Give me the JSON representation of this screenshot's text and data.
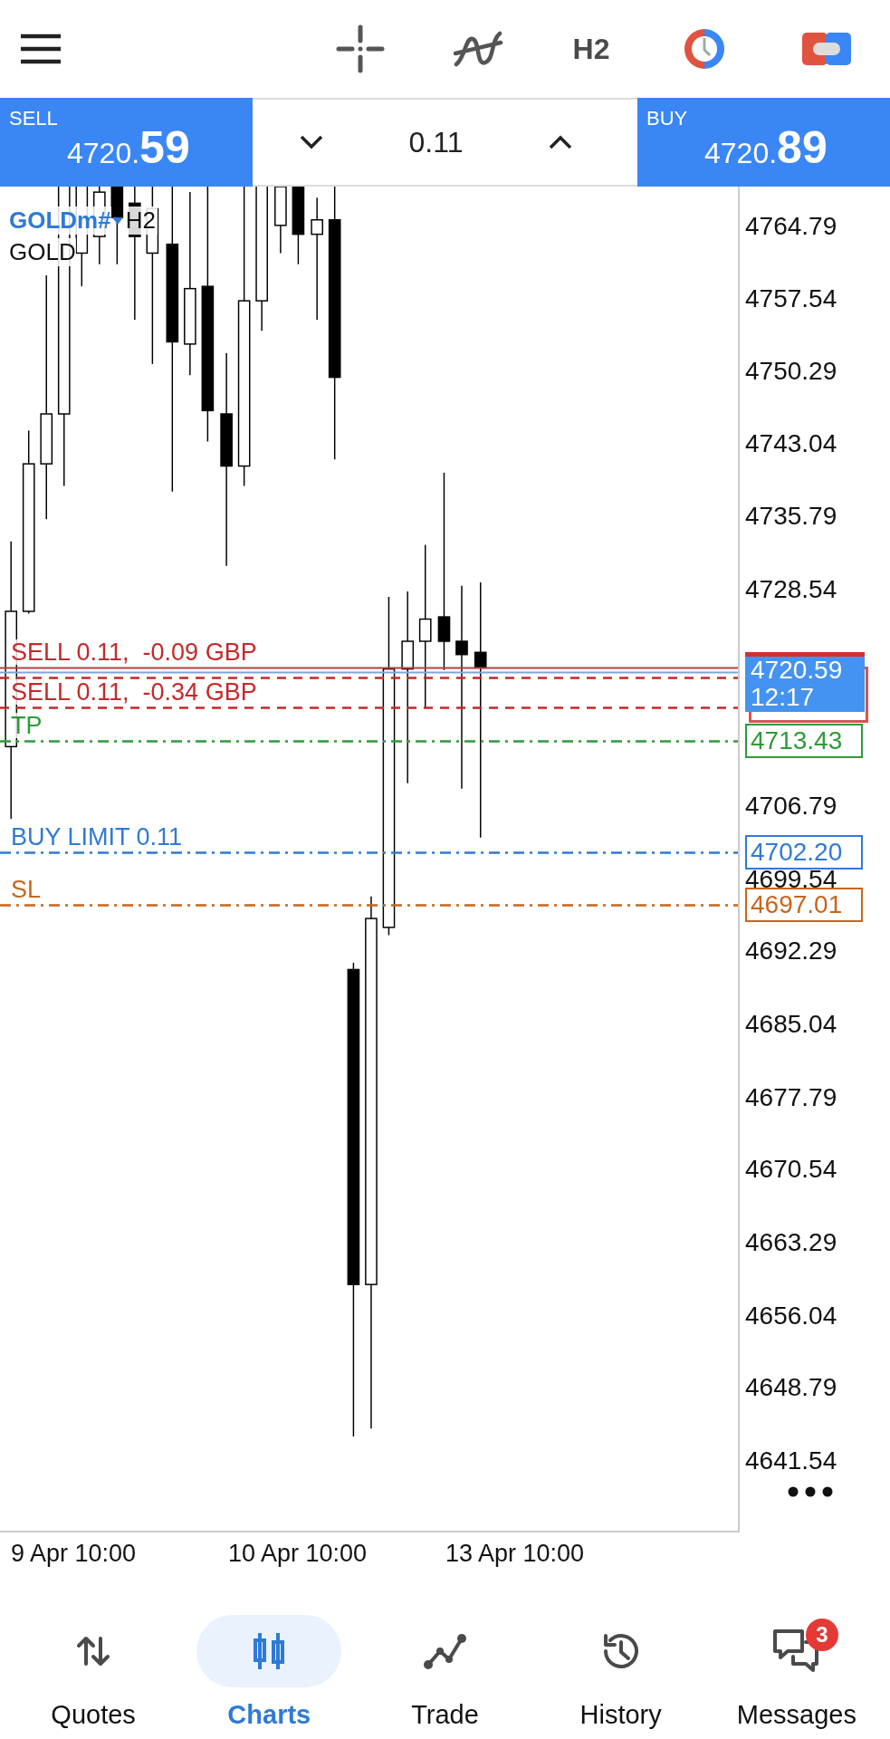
{
  "toolbar": {
    "period": "H2"
  },
  "trade_panel": {
    "sell": {
      "label": "SELL",
      "price_main": "4720.",
      "price_big": "59"
    },
    "volume": "0.11",
    "buy": {
      "label": "BUY",
      "price_main": "4720.",
      "price_big": "89"
    }
  },
  "chart": {
    "symbol": "GOLDm#",
    "timeframe": "H2",
    "description": "GOLD",
    "price_axis": [
      "4764.79",
      "4757.54",
      "4750.29",
      "4743.04",
      "4735.79",
      "4728.54",
      "4706.79",
      "4699.54",
      "4692.29",
      "4685.04",
      "4677.79",
      "4670.54",
      "4663.29",
      "4656.04",
      "4648.79",
      "4641.54"
    ],
    "order_lines": [
      {
        "kind": "position",
        "label": "SELL 0.11,  -0.09 GBP",
        "color": "#c62828"
      },
      {
        "kind": "position",
        "label": "SELL 0.11,  -0.34 GBP",
        "color": "#c62828"
      },
      {
        "kind": "tp",
        "label": "TP",
        "price": "4713.43",
        "color": "#2e9a3a"
      },
      {
        "kind": "limit",
        "label": "BUY LIMIT 0.11",
        "price": "4702.20",
        "color": "#2f7ad6"
      },
      {
        "kind": "sl",
        "label": "SL",
        "price": "4697.01",
        "color": "#c8651b"
      }
    ],
    "current_price": {
      "price": "4720.59",
      "time": "12:17"
    },
    "time_axis": [
      "9 Apr 10:00",
      "10 Apr 10:00",
      "13 Apr 10:00"
    ]
  },
  "nav": [
    {
      "label": "Quotes",
      "selected": false
    },
    {
      "label": "Charts",
      "selected": true
    },
    {
      "label": "Trade",
      "selected": false
    },
    {
      "label": "History",
      "selected": false
    },
    {
      "label": "Messages",
      "selected": false,
      "badge": "3"
    }
  ]
}
